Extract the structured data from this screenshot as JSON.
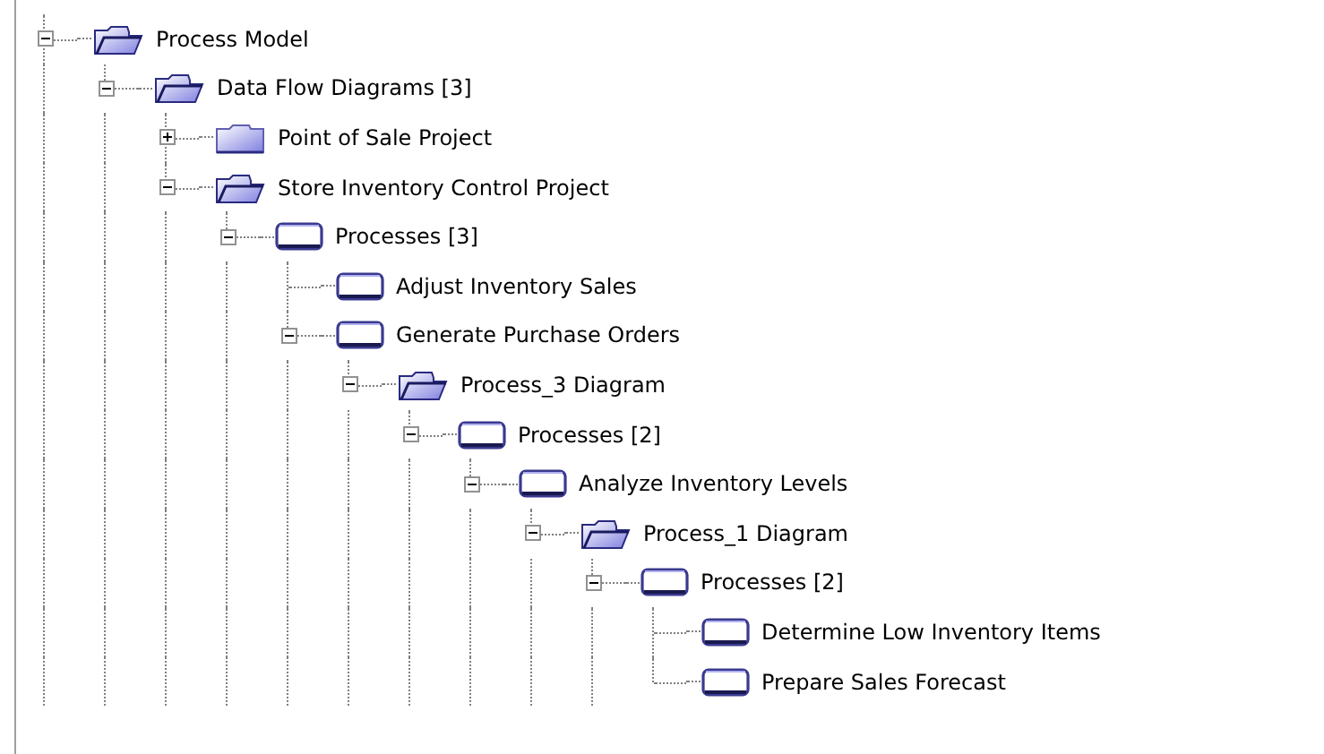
{
  "tree": [
    {
      "label": "Process Model",
      "kind": "diagram",
      "expanded": true,
      "children": [
        {
          "label": "Data Flow Diagrams [3]",
          "kind": "diagram",
          "expanded": true,
          "children": [
            {
              "label": "Point of Sale Project",
              "kind": "diagram",
              "expanded": false
            },
            {
              "label": "Store Inventory Control Project",
              "kind": "diagram",
              "expanded": true,
              "children": [
                {
                  "label": "Processes [3]",
                  "kind": "process",
                  "expanded": true,
                  "children": [
                    {
                      "label": "Adjust Inventory Sales",
                      "kind": "process"
                    },
                    {
                      "label": "Generate Purchase Orders",
                      "kind": "process",
                      "expanded": true,
                      "children": [
                        {
                          "label": "Process_3 Diagram",
                          "kind": "diagram",
                          "expanded": true,
                          "children": [
                            {
                              "label": "Processes [2]",
                              "kind": "process",
                              "expanded": true,
                              "children": [
                                {
                                  "label": "Analyze Inventory Levels",
                                  "kind": "process",
                                  "expanded": true,
                                  "children": [
                                    {
                                      "label": "Process_1 Diagram",
                                      "kind": "diagram",
                                      "expanded": true,
                                      "children": [
                                        {
                                          "label": "Processes [2]",
                                          "kind": "process",
                                          "expanded": true,
                                          "children": [
                                            {
                                              "label": "Determine Low Inventory Items",
                                              "kind": "process"
                                            },
                                            {
                                              "label": "Prepare Sales Forecast",
                                              "kind": "process"
                                            }
                                          ]
                                        }
                                      ]
                                    }
                                  ]
                                }
                              ]
                            }
                          ]
                        }
                      ]
                    }
                  ]
                }
              ]
            }
          ]
        }
      ]
    }
  ]
}
